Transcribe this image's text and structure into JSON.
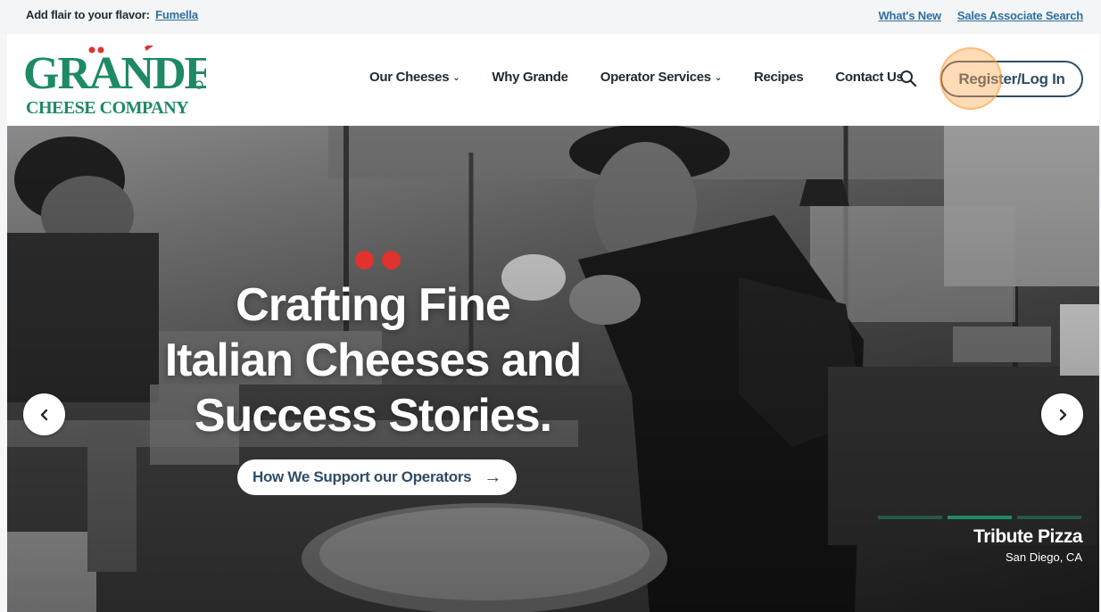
{
  "topbar": {
    "flair_text": "Add flair to your flavor:",
    "flair_link": "Fumella",
    "links": [
      "What's New",
      "Sales Associate Search"
    ]
  },
  "brand": {
    "logo_alt": "Grande Cheese Company",
    "green": "#1d8a64",
    "red": "#e0322f",
    "navy": "#2f4d66"
  },
  "nav": {
    "items": [
      {
        "label": "Our Cheeses",
        "dropdown": true
      },
      {
        "label": "Why Grande",
        "dropdown": false
      },
      {
        "label": "Operator Services",
        "dropdown": true
      },
      {
        "label": "Recipes",
        "dropdown": false
      },
      {
        "label": "Contact Us",
        "dropdown": false
      }
    ],
    "search_icon": "search-icon",
    "register_label": "Register/Log In"
  },
  "hero": {
    "headline_line1": "Crafting Fine",
    "headline_line2": "Italian Cheeses and",
    "headline_line3": "Success Stories.",
    "cta_label": "How We Support our Operators",
    "cta_icon": "arrow-right-icon",
    "prev_icon": "chevron-left-icon",
    "next_icon": "chevron-right-icon",
    "slides_total": 3,
    "active_slide": 2,
    "caption_name": "Tribute Pizza",
    "caption_location": "San Diego, CA"
  }
}
